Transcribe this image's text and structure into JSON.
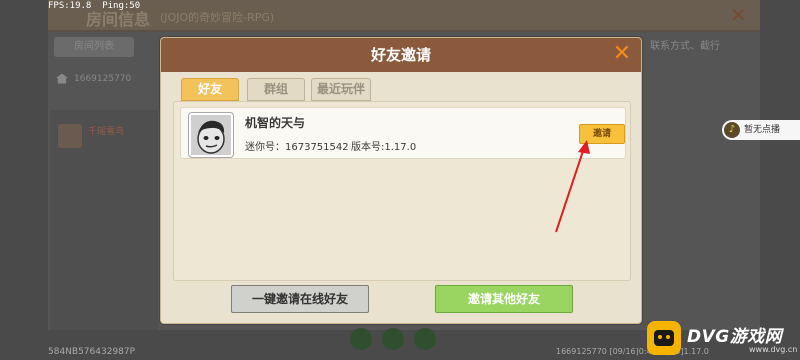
{
  "status_bar": {
    "fps": "FPS:19.8",
    "ping": "Ping:50"
  },
  "background": {
    "title": "房间信息",
    "subtitle": "(JOJO的奇妙冒险-RPG)",
    "tab_room_list": "房间列表",
    "room_id": "1669125770",
    "right_text": "联系方式、截行",
    "player_name": "千瑶雪鸟",
    "bottom_left": "584NB576432987P",
    "bottom_right": "1669125770  [09/16]0:48:0  [63]1.17.0"
  },
  "music": {
    "label": "暂无点播"
  },
  "modal": {
    "title": "好友邀请",
    "tabs": [
      {
        "label": "好友",
        "active": true
      },
      {
        "label": "群组",
        "active": false
      },
      {
        "label": "最近玩伴",
        "active": false
      }
    ],
    "friends": [
      {
        "name": "机智的天与",
        "mini_id_label": "迷你号：",
        "mini_id": "1673751542",
        "version_label": "版本号:",
        "version": "1.17.0",
        "invite_label": "邀请"
      }
    ],
    "btn_invite_online": "一键邀请在线好友",
    "btn_invite_others": "邀请其他好友"
  },
  "watermark": {
    "title": "DVG游戏网",
    "url": "www.dvg.cn"
  },
  "colors": {
    "header_brown": "#8b5a3c",
    "tab_active": "#f2c35a",
    "invite_yellow": "#f7c13c",
    "green_button": "#9ad561",
    "close_orange": "#f58a1f",
    "arrow_red": "#e02020"
  }
}
